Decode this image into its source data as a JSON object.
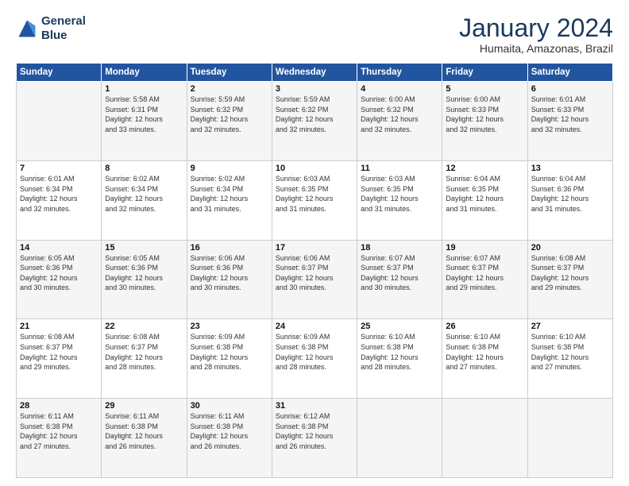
{
  "logo": {
    "line1": "General",
    "line2": "Blue"
  },
  "title": "January 2024",
  "subtitle": "Humaita, Amazonas, Brazil",
  "header_days": [
    "Sunday",
    "Monday",
    "Tuesday",
    "Wednesday",
    "Thursday",
    "Friday",
    "Saturday"
  ],
  "weeks": [
    [
      {
        "day": "",
        "info": ""
      },
      {
        "day": "1",
        "info": "Sunrise: 5:58 AM\nSunset: 6:31 PM\nDaylight: 12 hours\nand 33 minutes."
      },
      {
        "day": "2",
        "info": "Sunrise: 5:59 AM\nSunset: 6:32 PM\nDaylight: 12 hours\nand 32 minutes."
      },
      {
        "day": "3",
        "info": "Sunrise: 5:59 AM\nSunset: 6:32 PM\nDaylight: 12 hours\nand 32 minutes."
      },
      {
        "day": "4",
        "info": "Sunrise: 6:00 AM\nSunset: 6:32 PM\nDaylight: 12 hours\nand 32 minutes."
      },
      {
        "day": "5",
        "info": "Sunrise: 6:00 AM\nSunset: 6:33 PM\nDaylight: 12 hours\nand 32 minutes."
      },
      {
        "day": "6",
        "info": "Sunrise: 6:01 AM\nSunset: 6:33 PM\nDaylight: 12 hours\nand 32 minutes."
      }
    ],
    [
      {
        "day": "7",
        "info": "Sunrise: 6:01 AM\nSunset: 6:34 PM\nDaylight: 12 hours\nand 32 minutes."
      },
      {
        "day": "8",
        "info": "Sunrise: 6:02 AM\nSunset: 6:34 PM\nDaylight: 12 hours\nand 32 minutes."
      },
      {
        "day": "9",
        "info": "Sunrise: 6:02 AM\nSunset: 6:34 PM\nDaylight: 12 hours\nand 31 minutes."
      },
      {
        "day": "10",
        "info": "Sunrise: 6:03 AM\nSunset: 6:35 PM\nDaylight: 12 hours\nand 31 minutes."
      },
      {
        "day": "11",
        "info": "Sunrise: 6:03 AM\nSunset: 6:35 PM\nDaylight: 12 hours\nand 31 minutes."
      },
      {
        "day": "12",
        "info": "Sunrise: 6:04 AM\nSunset: 6:35 PM\nDaylight: 12 hours\nand 31 minutes."
      },
      {
        "day": "13",
        "info": "Sunrise: 6:04 AM\nSunset: 6:36 PM\nDaylight: 12 hours\nand 31 minutes."
      }
    ],
    [
      {
        "day": "14",
        "info": "Sunrise: 6:05 AM\nSunset: 6:36 PM\nDaylight: 12 hours\nand 30 minutes."
      },
      {
        "day": "15",
        "info": "Sunrise: 6:05 AM\nSunset: 6:36 PM\nDaylight: 12 hours\nand 30 minutes."
      },
      {
        "day": "16",
        "info": "Sunrise: 6:06 AM\nSunset: 6:36 PM\nDaylight: 12 hours\nand 30 minutes."
      },
      {
        "day": "17",
        "info": "Sunrise: 6:06 AM\nSunset: 6:37 PM\nDaylight: 12 hours\nand 30 minutes."
      },
      {
        "day": "18",
        "info": "Sunrise: 6:07 AM\nSunset: 6:37 PM\nDaylight: 12 hours\nand 30 minutes."
      },
      {
        "day": "19",
        "info": "Sunrise: 6:07 AM\nSunset: 6:37 PM\nDaylight: 12 hours\nand 29 minutes."
      },
      {
        "day": "20",
        "info": "Sunrise: 6:08 AM\nSunset: 6:37 PM\nDaylight: 12 hours\nand 29 minutes."
      }
    ],
    [
      {
        "day": "21",
        "info": "Sunrise: 6:08 AM\nSunset: 6:37 PM\nDaylight: 12 hours\nand 29 minutes."
      },
      {
        "day": "22",
        "info": "Sunrise: 6:08 AM\nSunset: 6:37 PM\nDaylight: 12 hours\nand 28 minutes."
      },
      {
        "day": "23",
        "info": "Sunrise: 6:09 AM\nSunset: 6:38 PM\nDaylight: 12 hours\nand 28 minutes."
      },
      {
        "day": "24",
        "info": "Sunrise: 6:09 AM\nSunset: 6:38 PM\nDaylight: 12 hours\nand 28 minutes."
      },
      {
        "day": "25",
        "info": "Sunrise: 6:10 AM\nSunset: 6:38 PM\nDaylight: 12 hours\nand 28 minutes."
      },
      {
        "day": "26",
        "info": "Sunrise: 6:10 AM\nSunset: 6:38 PM\nDaylight: 12 hours\nand 27 minutes."
      },
      {
        "day": "27",
        "info": "Sunrise: 6:10 AM\nSunset: 6:38 PM\nDaylight: 12 hours\nand 27 minutes."
      }
    ],
    [
      {
        "day": "28",
        "info": "Sunrise: 6:11 AM\nSunset: 6:38 PM\nDaylight: 12 hours\nand 27 minutes."
      },
      {
        "day": "29",
        "info": "Sunrise: 6:11 AM\nSunset: 6:38 PM\nDaylight: 12 hours\nand 26 minutes."
      },
      {
        "day": "30",
        "info": "Sunrise: 6:11 AM\nSunset: 6:38 PM\nDaylight: 12 hours\nand 26 minutes."
      },
      {
        "day": "31",
        "info": "Sunrise: 6:12 AM\nSunset: 6:38 PM\nDaylight: 12 hours\nand 26 minutes."
      },
      {
        "day": "",
        "info": ""
      },
      {
        "day": "",
        "info": ""
      },
      {
        "day": "",
        "info": ""
      }
    ]
  ]
}
